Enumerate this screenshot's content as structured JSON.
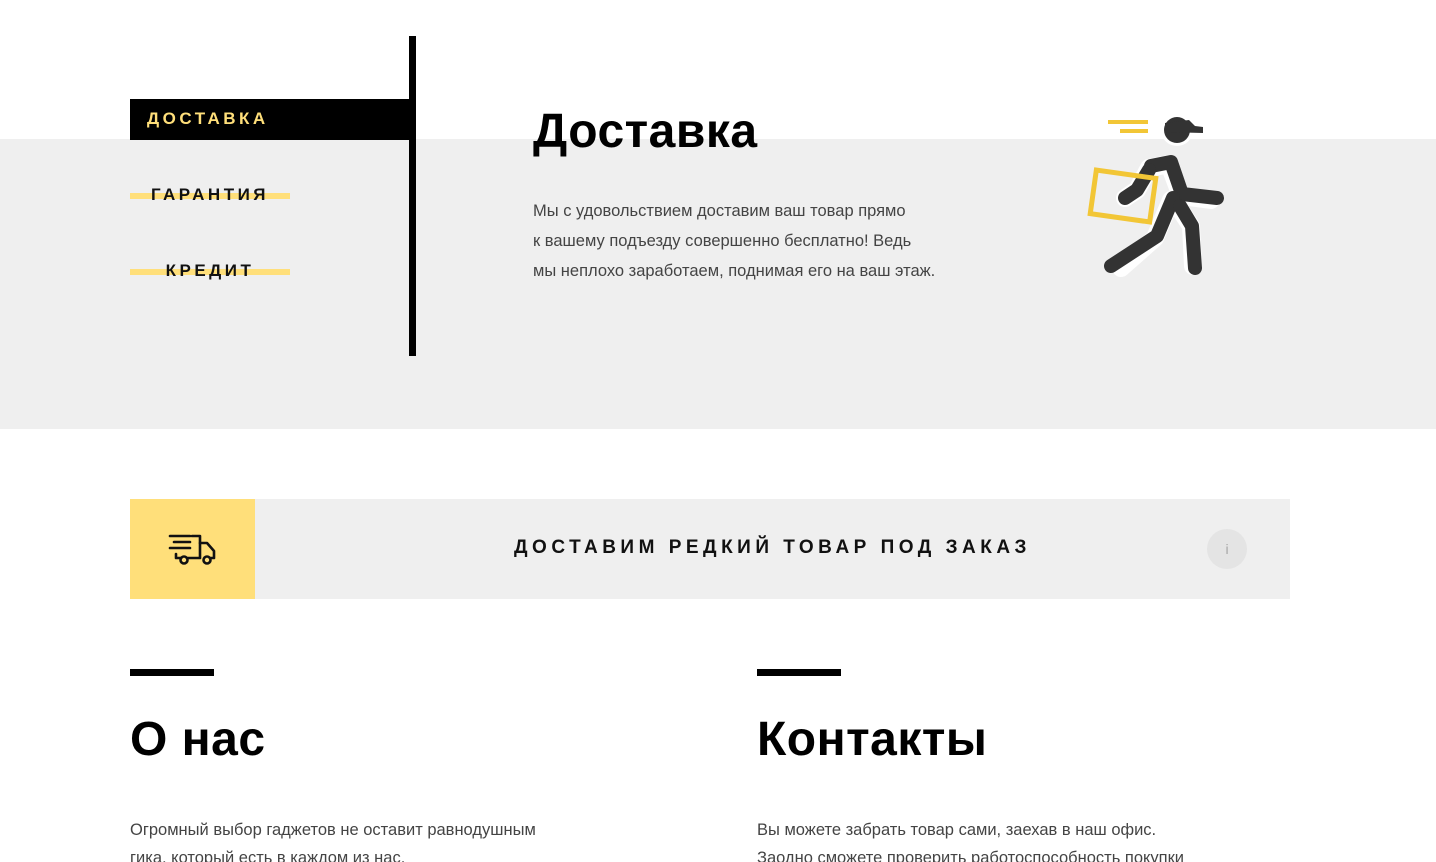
{
  "tabs": [
    {
      "label": "Доставка"
    },
    {
      "label": "Гарантия"
    },
    {
      "label": "Кредит"
    }
  ],
  "hero": {
    "title": "Доставка",
    "lines": [
      "Мы с удовольствием доставим ваш товар прямо",
      "к вашему подъезду совершенно бесплатно! Ведь",
      "мы неплохо заработаем, поднимая его на ваш этаж."
    ],
    "illustration": "running-courier-icon"
  },
  "banner": {
    "icon": "delivery-truck-icon",
    "title": "Доставим редкий товар под заказ",
    "info_label": "i"
  },
  "about": {
    "title": "О нас",
    "lines": [
      "Огромный выбор гаджетов не оставит равнодушным",
      "гика, который есть в каждом из нас."
    ]
  },
  "contacts": {
    "title": "Контакты",
    "lines": [
      "Вы можете забрать товар сами, заехав в наш офис.",
      "Заодно сможете проверить работоспособность покупки"
    ]
  },
  "colors": {
    "accent_yellow": "#ffdf7a",
    "band_gray": "#efefef",
    "black": "#000000"
  }
}
